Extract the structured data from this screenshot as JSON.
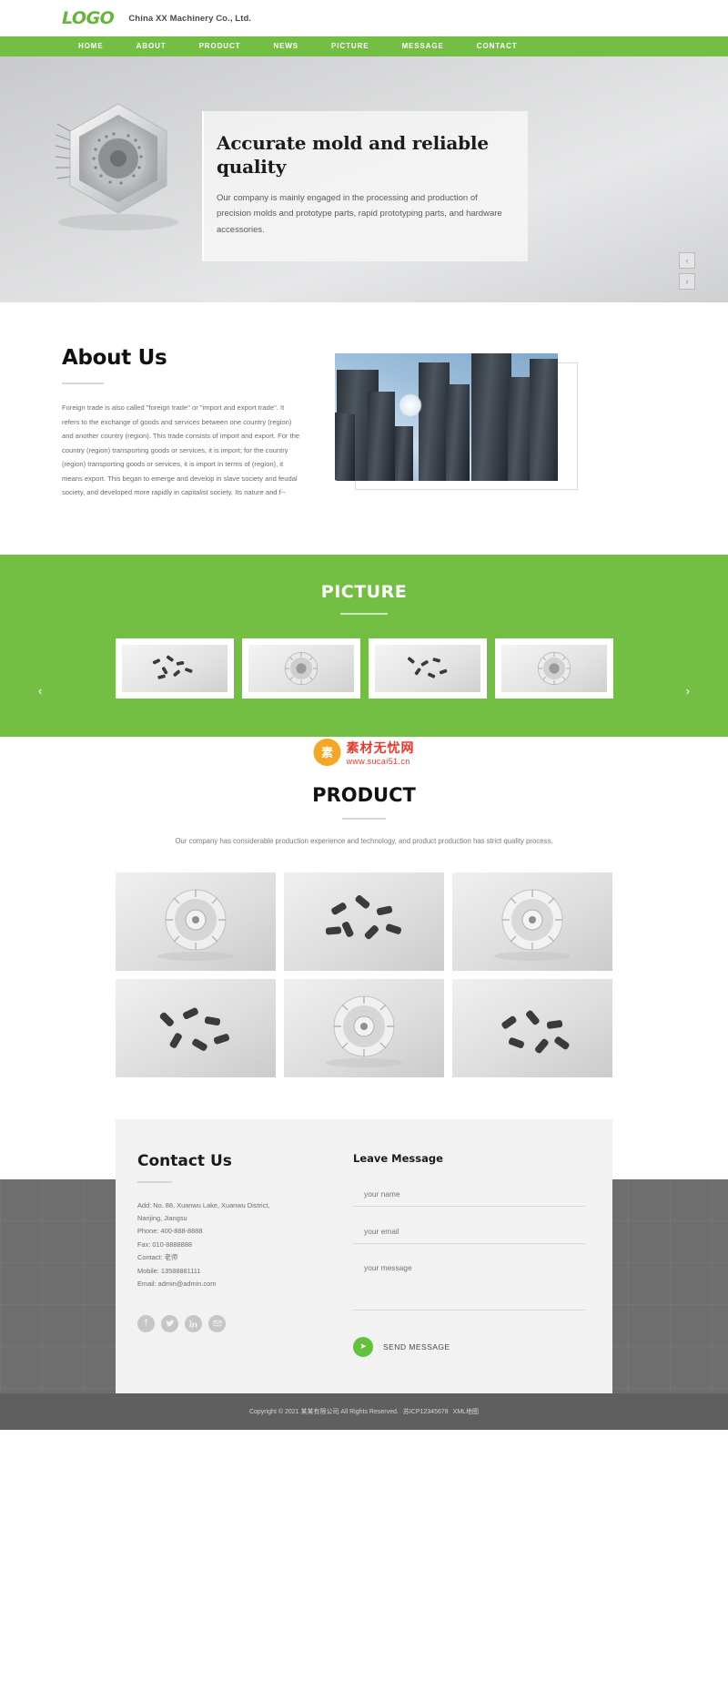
{
  "header": {
    "logo": "LOGO",
    "company": "China XX Machinery Co., Ltd.",
    "nav": [
      {
        "label": "HOME"
      },
      {
        "label": "ABOUT"
      },
      {
        "label": "PRODUCT"
      },
      {
        "label": "NEWS"
      },
      {
        "label": "PICTURE"
      },
      {
        "label": "MESSAGE"
      },
      {
        "label": "CONTACT"
      }
    ]
  },
  "banner": {
    "title": "Accurate mold and reliable quality",
    "desc": "Our company is mainly engaged in the processing and production of precision molds and prototype parts, rapid prototyping parts, and hardware accessories.",
    "prev": "‹",
    "next": "›"
  },
  "about": {
    "title": "About Us",
    "text": "Foreign trade is also called \"foreign trade\" or \"import and export trade\". It refers to the exchange of goods and services between one country (region) and another country (region). This trade consists of import and export. For the country (region) transporting goods or services, it is import; for the country (region) transporting goods or services, it is import In terms of (region), it means export. This began to emerge and develop in slave society and feudal society, and developed more rapidly in capitalist society. Its nature and f--"
  },
  "picture": {
    "title": "PICTURE",
    "prev": "‹",
    "next": "›",
    "slides": [
      {
        "alt": "screws-photo"
      },
      {
        "alt": "gear-mold-photo"
      },
      {
        "alt": "screws-photo"
      },
      {
        "alt": "gear-mold-photo"
      }
    ]
  },
  "watermark": {
    "mark": "素",
    "line1": "素材无忧网",
    "line2": "www.sucai51.cn"
  },
  "product": {
    "title": "PRODUCT",
    "desc": "Our company has considerable production experience and technology, and product production has strict quality process.",
    "items": [
      {
        "alt": "gear-mold-product"
      },
      {
        "alt": "screws-product"
      },
      {
        "alt": "gear-mold-product"
      },
      {
        "alt": "screws-product"
      },
      {
        "alt": "gear-mold-product"
      },
      {
        "alt": "screws-product"
      }
    ]
  },
  "contact": {
    "title": "Contact Us",
    "lines": [
      "Add: No. 88, Xuanwu Lake, Xuanwu District,",
      "Nanjing, Jiangsu",
      "Phone: 400-888-8888",
      "Fax: 010-8888888",
      "Contact: 老师",
      "Mobile: 13588881111",
      "Email: admin@admin.com"
    ],
    "socials": [
      {
        "name": "facebook",
        "glyph": "f"
      },
      {
        "name": "twitter",
        "glyph": "ᵗ"
      },
      {
        "name": "linkedin",
        "glyph": "in"
      },
      {
        "name": "email",
        "glyph": "✉"
      }
    ]
  },
  "form": {
    "title": "Leave Message",
    "name_placeholder": "your name",
    "email_placeholder": "your email",
    "message_placeholder": "your message",
    "send_label": "SEND MESSAGE",
    "send_icon": "➤"
  },
  "footer": {
    "copyright": "Copyright © 2021 某某有限公司 All Rights Reserved.",
    "icp": "苏ICP12345678",
    "sitemap": "XML地图"
  },
  "colors": {
    "brand_green": "#73bf44",
    "send_green": "#63c13f",
    "footer_gray": "#5f5f5f"
  }
}
